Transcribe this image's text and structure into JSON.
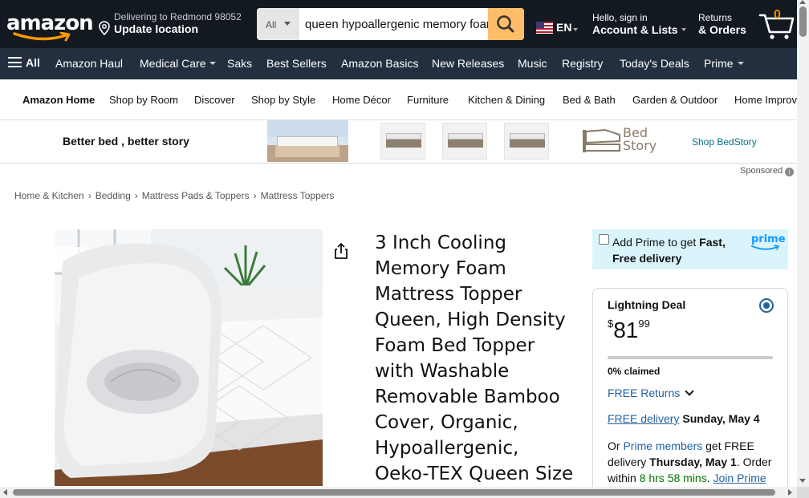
{
  "header": {
    "logo_text": "amazon",
    "deliver_line1": "Delivering to Redmond 98052",
    "deliver_line2": "Update location",
    "search_category": "All",
    "search_value": "queen hypoallergenic memory foam mattress topper",
    "language": "EN",
    "account_line1": "Hello, sign in",
    "account_line2": "Account & Lists",
    "returns_line1": "Returns",
    "returns_line2": "& Orders",
    "cart_count": "0"
  },
  "nav": {
    "all_label": "All",
    "items": [
      "Amazon Haul",
      "Medical Care",
      "Saks",
      "Best Sellers",
      "Amazon Basics",
      "New Releases",
      "Music",
      "Registry",
      "Today's Deals",
      "Prime"
    ]
  },
  "subnav": {
    "items": [
      "Amazon Home",
      "Shop by Room",
      "Discover",
      "Shop by Style",
      "Home Décor",
      "Furniture",
      "Kitchen & Dining",
      "Bed & Bath",
      "Garden & Outdoor",
      "Home Improvement"
    ]
  },
  "banner": {
    "tagline": "Better bed , better story",
    "brand_name_line1": "Bed",
    "brand_name_line2": "Story",
    "shop_link": "Shop BedStory",
    "sponsored": "Sponsored",
    "info_glyph": "i"
  },
  "breadcrumb": [
    "Home & Kitchen",
    "Bedding",
    "Mattress Pads & Toppers",
    "Mattress Toppers"
  ],
  "breadcrumb_sep": "›",
  "product": {
    "title": "3 Inch Cooling Memory Foam Mattress Topper Queen, High Density Foam Bed Topper with Washable Removable Bamboo Cover, Organic, Hypoallergenic, Oeko-TEX Queen Size"
  },
  "prime_offer": {
    "text_pre": "Add Prime to get ",
    "text_bold": "Fast, Free delivery",
    "logo": "prime"
  },
  "buybox": {
    "deal_label": "Lightning Deal",
    "price_currency": "$",
    "price_whole": "81",
    "price_fraction": "99",
    "claimed_percent": 0,
    "claimed_text": "0% claimed",
    "free_returns": "FREE Returns",
    "free_delivery_link": "FREE delivery",
    "delivery_date": "Sunday, May 4",
    "alt_or": "Or ",
    "alt_prime_members": "Prime members",
    "alt_get_free": " get FREE delivery ",
    "alt_date": "Thursday, May 1",
    "alt_order_within": ". Order within ",
    "alt_time": "8 hrs 58 mins",
    "alt_join": "Join Prime"
  },
  "colors": {
    "nav_dark": "#131921",
    "nav_secondary": "#232f3e",
    "search_button": "#febd69",
    "link": "#2162a1",
    "cart_count": "#f08804",
    "prime_box": "#daf4fb"
  }
}
